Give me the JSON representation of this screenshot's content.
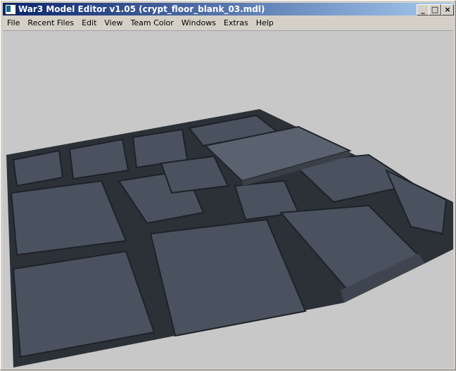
{
  "window": {
    "title": "War3 Model Editor v1.05 (crypt_floor_blank_03.mdl)",
    "buttons": {
      "minimize": "_",
      "maximize": "□",
      "close": "×"
    }
  },
  "menu": [
    "File",
    "Recent Files",
    "Edit",
    "View",
    "Team Color",
    "Windows",
    "Extras",
    "Help"
  ],
  "viewport": {
    "background": "#c8c8c8"
  }
}
